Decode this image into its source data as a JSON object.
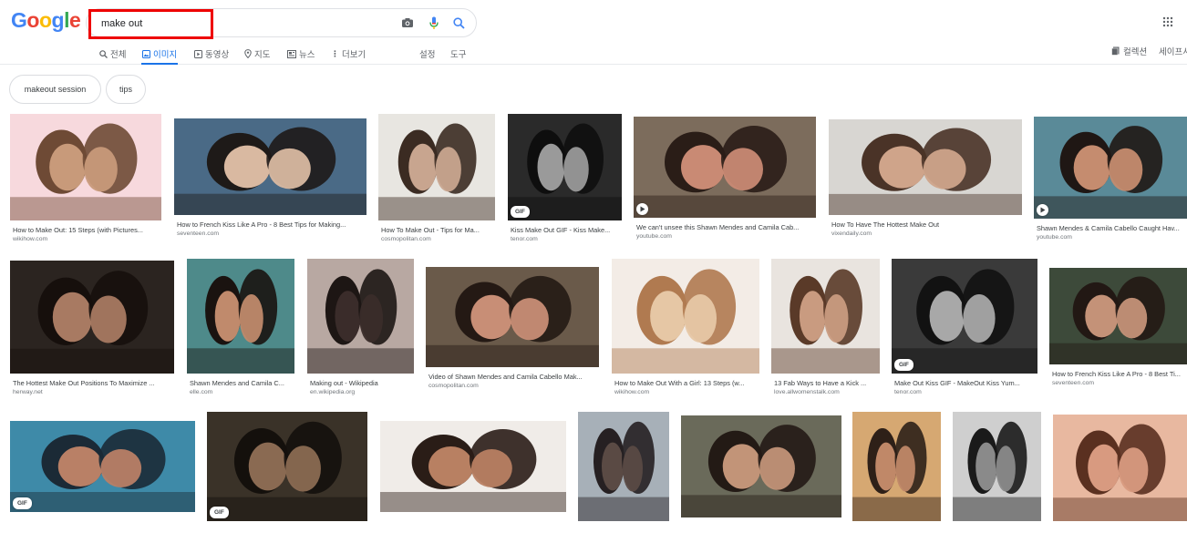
{
  "header": {
    "logo": "Google",
    "search": {
      "value": "make out"
    },
    "tabs": [
      "전체",
      "이미지",
      "동영상",
      "지도",
      "뉴스",
      "더보기"
    ],
    "settings_label": "설정",
    "tools_label": "도구",
    "collection_label": "컬렉션",
    "safesearch_label": "세이프서"
  },
  "chips": [
    "makeout session",
    "tips"
  ],
  "results": [
    {
      "caption": "How to Make Out: 15 Steps (with Pictures...",
      "source": "wikihow.com",
      "badge": "",
      "colors": [
        "#f7d9dd",
        "#c89a7a",
        "#6e4a35"
      ]
    },
    {
      "caption": "How to French Kiss Like A Pro - 8 Best Tips for Making...",
      "source": "seventeen.com",
      "badge": "",
      "colors": [
        "#4a6a86",
        "#d9b9a1",
        "#1e1a18"
      ]
    },
    {
      "caption": "How To Make Out - Tips for Ma...",
      "source": "cosmopolitan.com",
      "badge": "",
      "colors": [
        "#e8e6e1",
        "#c8a58f",
        "#3b2b22"
      ]
    },
    {
      "caption": "Kiss Make Out GIF - Kiss Make...",
      "source": "tenor.com",
      "badge": "GIF",
      "colors": [
        "#2a2a2a",
        "#9a9a9a",
        "#0e0e0e"
      ]
    },
    {
      "caption": "We can't unsee this Shawn Mendes and Camila Cab...",
      "source": "youtube.com",
      "badge": "play",
      "colors": [
        "#7c6c5c",
        "#c98a74",
        "#2a1d17"
      ]
    },
    {
      "caption": "How To Have The Hottest Make Out",
      "source": "vixendaily.com",
      "badge": "",
      "colors": [
        "#d8d6d2",
        "#cfa48a",
        "#4a3327"
      ]
    },
    {
      "caption": "Shawn Mendes & Camila Cabello Caught Hav...",
      "source": "youtube.com",
      "badge": "play",
      "colors": [
        "#5a8a98",
        "#c58c6f",
        "#1f1714"
      ]
    },
    {
      "caption": "The Hottest Make Out Positions To Maximize ...",
      "source": "herway.net",
      "badge": "",
      "colors": [
        "#2b2420",
        "#a87a62",
        "#160f0c"
      ]
    },
    {
      "caption": "Shawn Mendes and Camila C...",
      "source": "elle.com",
      "badge": "",
      "colors": [
        "#4e8a8a",
        "#c08a6c",
        "#1a1310"
      ]
    },
    {
      "caption": "Making out - Wikipedia",
      "source": "en.wikipedia.org",
      "badge": "",
      "colors": [
        "#b8a8a2",
        "#3a2c2a",
        "#1d1614"
      ]
    },
    {
      "caption": "Video of Shawn Mendes and Camila Cabello Mak...",
      "source": "cosmopolitan.com",
      "badge": "",
      "colors": [
        "#6a5a4a",
        "#c88e76",
        "#241914"
      ]
    },
    {
      "caption": "How to Make Out With a Girl: 13 Steps (w...",
      "source": "wikihow.com",
      "badge": "",
      "colors": [
        "#f3ece6",
        "#e6c7a5",
        "#b07a50"
      ]
    },
    {
      "caption": "13 Fab Ways to Have a Kick ...",
      "source": "love.allwomenstalk.com",
      "badge": "",
      "colors": [
        "#e9e4df",
        "#c99b80",
        "#5a3a28"
      ]
    },
    {
      "caption": "Make Out Kiss GIF - MakeOut Kiss Yum...",
      "source": "tenor.com",
      "badge": "GIF",
      "colors": [
        "#3a3a3a",
        "#a8a8a8",
        "#121212"
      ]
    },
    {
      "caption": "How to French Kiss Like A Pro - 8 Best Ti...",
      "source": "seventeen.com",
      "badge": "",
      "colors": [
        "#3d4a3a",
        "#c49278",
        "#221814"
      ]
    },
    {
      "caption": "",
      "source": "",
      "badge": "GIF",
      "colors": [
        "#3e8aa8",
        "#b98066",
        "#1b2a36"
      ]
    },
    {
      "caption": "",
      "source": "",
      "badge": "GIF",
      "colors": [
        "#3a3228",
        "#8a6a52",
        "#14100c"
      ]
    },
    {
      "caption": "",
      "source": "",
      "badge": "",
      "colors": [
        "#f0ece8",
        "#b88062",
        "#2a1d17"
      ]
    },
    {
      "caption": "",
      "source": "",
      "badge": "",
      "colors": [
        "#a7b0b8",
        "#5a4a44",
        "#262022"
      ]
    },
    {
      "caption": "",
      "source": "",
      "badge": "",
      "colors": [
        "#6a6a5a",
        "#c29478",
        "#231a15"
      ]
    },
    {
      "caption": "",
      "source": "",
      "badge": "",
      "colors": [
        "#d6a872",
        "#c08868",
        "#2e2018"
      ]
    },
    {
      "caption": "",
      "source": "",
      "badge": "",
      "colors": [
        "#cfcfcf",
        "#8a8a8a",
        "#1a1a1a"
      ]
    },
    {
      "caption": "",
      "source": "",
      "badge": "",
      "colors": [
        "#e8b8a0",
        "#d89a80",
        "#5a3020"
      ]
    }
  ]
}
